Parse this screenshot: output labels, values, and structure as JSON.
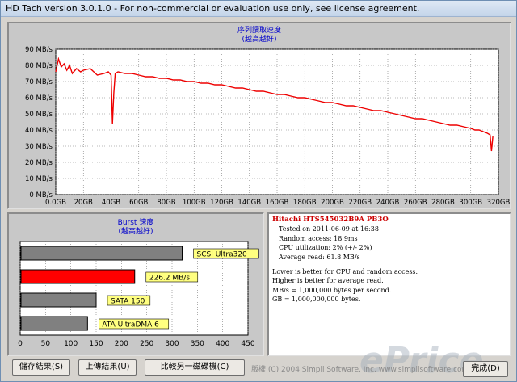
{
  "window": {
    "title": "HD Tach version 3.0.1.0  - For non-commercial or evaluation use only, see license agreement."
  },
  "sequential": {
    "title_line1": "序列讀取速度",
    "title_line2": "(越高越好)"
  },
  "chart_data": [
    {
      "type": "line",
      "title": "序列讀取速度 (越高越好)",
      "ylim": [
        0,
        90
      ],
      "xlim": [
        0,
        320
      ],
      "y_ticks": [
        "0 MB/s",
        "10 MB/s",
        "20 MB/s",
        "30 MB/s",
        "40 MB/s",
        "50 MB/s",
        "60 MB/s",
        "70 MB/s",
        "80 MB/s",
        "90 MB/s"
      ],
      "x_ticks": [
        "0.0GB",
        "20GB",
        "40GB",
        "60GB",
        "80GB",
        "100GB",
        "120GB",
        "140GB",
        "160GB",
        "180GB",
        "200GB",
        "220GB",
        "240GB",
        "260GB",
        "280GB",
        "300GB",
        "320GB"
      ],
      "grid": true,
      "series_color": "#ee0000",
      "x": [
        0,
        2,
        4,
        6,
        8,
        10,
        12,
        15,
        18,
        20,
        25,
        30,
        35,
        38,
        40,
        41,
        42,
        43,
        45,
        50,
        55,
        60,
        65,
        70,
        75,
        80,
        85,
        90,
        95,
        100,
        105,
        110,
        115,
        120,
        125,
        130,
        135,
        140,
        145,
        150,
        155,
        160,
        165,
        170,
        175,
        180,
        185,
        190,
        195,
        200,
        205,
        210,
        215,
        220,
        225,
        230,
        235,
        240,
        245,
        250,
        255,
        260,
        265,
        270,
        275,
        280,
        285,
        290,
        295,
        300,
        303,
        306,
        309,
        312,
        314,
        315,
        316
      ],
      "y": [
        76,
        84,
        79,
        81,
        77,
        80,
        75,
        78,
        76,
        77,
        78,
        74,
        75,
        76,
        74,
        44,
        63,
        75,
        76,
        75,
        75,
        74,
        73,
        73,
        72,
        72,
        71,
        71,
        70,
        70,
        69,
        69,
        68,
        68,
        67,
        66,
        66,
        65,
        64,
        64,
        63,
        62,
        62,
        61,
        60,
        60,
        59,
        58,
        57,
        57,
        56,
        55,
        55,
        54,
        53,
        52,
        52,
        51,
        50,
        49,
        48,
        47,
        47,
        46,
        45,
        44,
        43,
        43,
        42,
        41,
        40,
        40,
        39,
        38,
        37,
        27,
        36
      ]
    },
    {
      "type": "bar",
      "title": "Burst 速度 (越高越好)",
      "xlim": [
        0,
        450
      ],
      "x_ticks": [
        "0",
        "50",
        "100",
        "150",
        "200",
        "250",
        "300",
        "350",
        "400",
        "450"
      ],
      "categories": [
        "SCSI Ultra320",
        "226.2 MB/s",
        "SATA 150",
        "ATA UltraDMA 6"
      ],
      "values": [
        320,
        226.2,
        150,
        133
      ],
      "colors": [
        "#808080",
        "#ff0000",
        "#808080",
        "#808080"
      ]
    }
  ],
  "burst": {
    "title_line1": "Burst 速度",
    "title_line2": "(越高越好)"
  },
  "info": {
    "drive": "Hitachi HTS545032B9A PB3O",
    "tested": "Tested on 2011-06-09 at 16:38",
    "random_access": "Random access: 18.9ms",
    "cpu": "CPU utilization: 2% (+/- 2%)",
    "average_read": "Average read: 61.8 MB/s",
    "note1": "Lower is better for CPU and random access.",
    "note2": "Higher is better for average read.",
    "note3": "MB/s = 1,000,000 bytes per second.",
    "note4": "GB = 1,000,000,000 bytes."
  },
  "buttons": {
    "save": "儲存結果(S)",
    "upload": "上傳結果(U)",
    "compare": "比較另一磁碟機(C)",
    "done": "完成(D)"
  },
  "footer": {
    "copyright": "版權 (C) 2004 Simpli Software, Inc. www.simplisoftware.com",
    "watermark": "ePrice"
  }
}
